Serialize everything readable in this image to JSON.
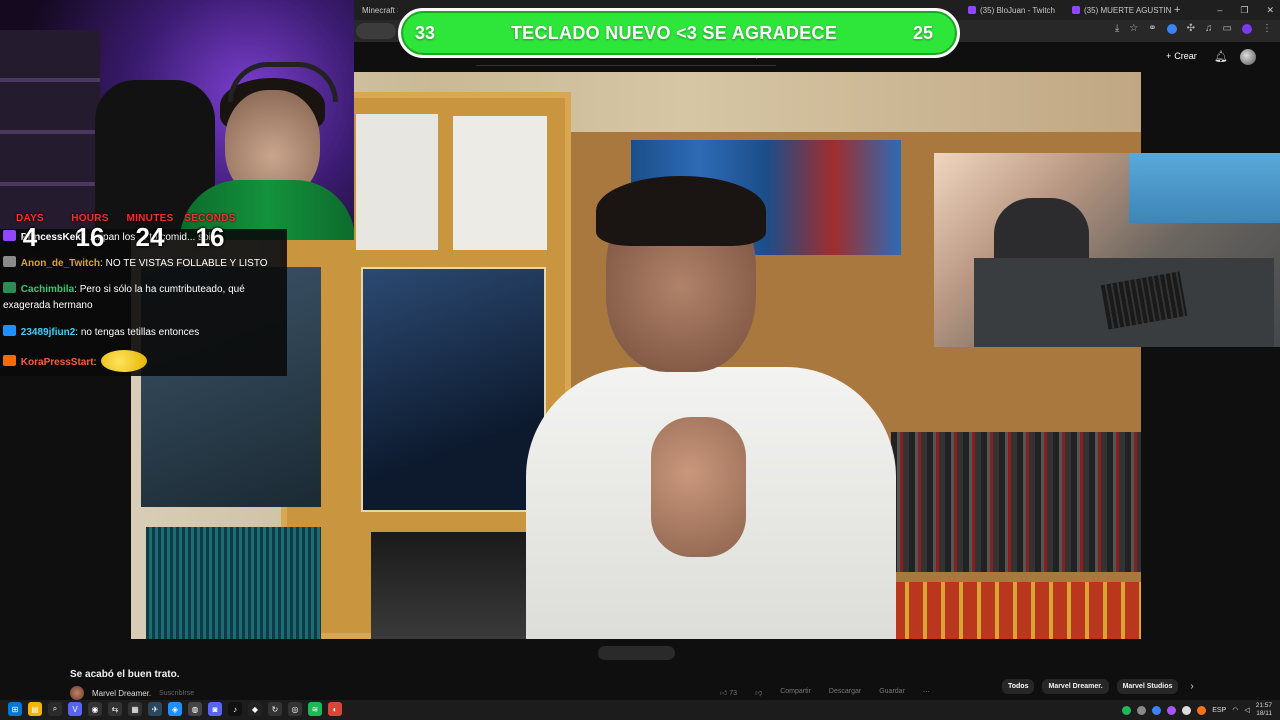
{
  "browser": {
    "tabs": [
      {
        "title": "Minecraft Skins - The..."
      },
      {
        "title": "(35) BloJuan - Twitch"
      },
      {
        "title": "(35) MUERTE AGUSTIN 5..."
      }
    ],
    "new_tab": "+",
    "window_controls": {
      "minimize": "–",
      "restore": "❐",
      "close": "✕"
    }
  },
  "youtube": {
    "create_label": "Crear",
    "video_title": "Se acabó el buen trato.",
    "channel_name": "Marvel Dreamer.",
    "channel_sub": "SuscribIrse",
    "actions": [
      "73",
      "Compartir",
      "Descargar",
      "Guardar"
    ],
    "chips": [
      "Todos",
      "Marvel Dreamer.",
      "Marvel Studios"
    ]
  },
  "banner": {
    "left_number": "33",
    "text": "TECLADO NUEVO <3 SE AGRADECE",
    "right_number": "25"
  },
  "timer": {
    "labels": [
      "DAYS",
      "HOURS",
      "MINUTES",
      "SECONDS"
    ],
    "values": [
      "4",
      "16",
      "24",
      "16"
    ]
  },
  "chat": {
    "messages": [
      {
        "user": "PrincessKeki",
        "text": "...ripan los ... to comid... soi",
        "badge_color": "#9147ff",
        "user_color": "#ffffff"
      },
      {
        "user": "Anon_de_Twitch",
        "text": "NO TE VISTAS FOLLABLE Y LISTO",
        "badge_color": "#8a8a8a",
        "user_color": "#daa520"
      },
      {
        "user": "Cachimbila",
        "text": "Pero si sólo la ha cumtributeado, qué exagerada hermano",
        "badge_color": "#2e8b57",
        "user_color": "#2ecc71"
      },
      {
        "user": "23489jfiun2",
        "text": "no tengas tetillas entonces",
        "badge_color": "#1e90ff",
        "user_color": "#3ccfff"
      },
      {
        "user": "KoraPressStart",
        "text": "",
        "badge_color": "#ff6a00",
        "user_color": "#ff5b3a"
      }
    ]
  },
  "taskbar": {
    "lang": "ESP",
    "time": "21:57",
    "date": "18/11"
  },
  "colors": {
    "banner_green": "#2ee53a",
    "timer_label_red": "#ff2a2a"
  }
}
